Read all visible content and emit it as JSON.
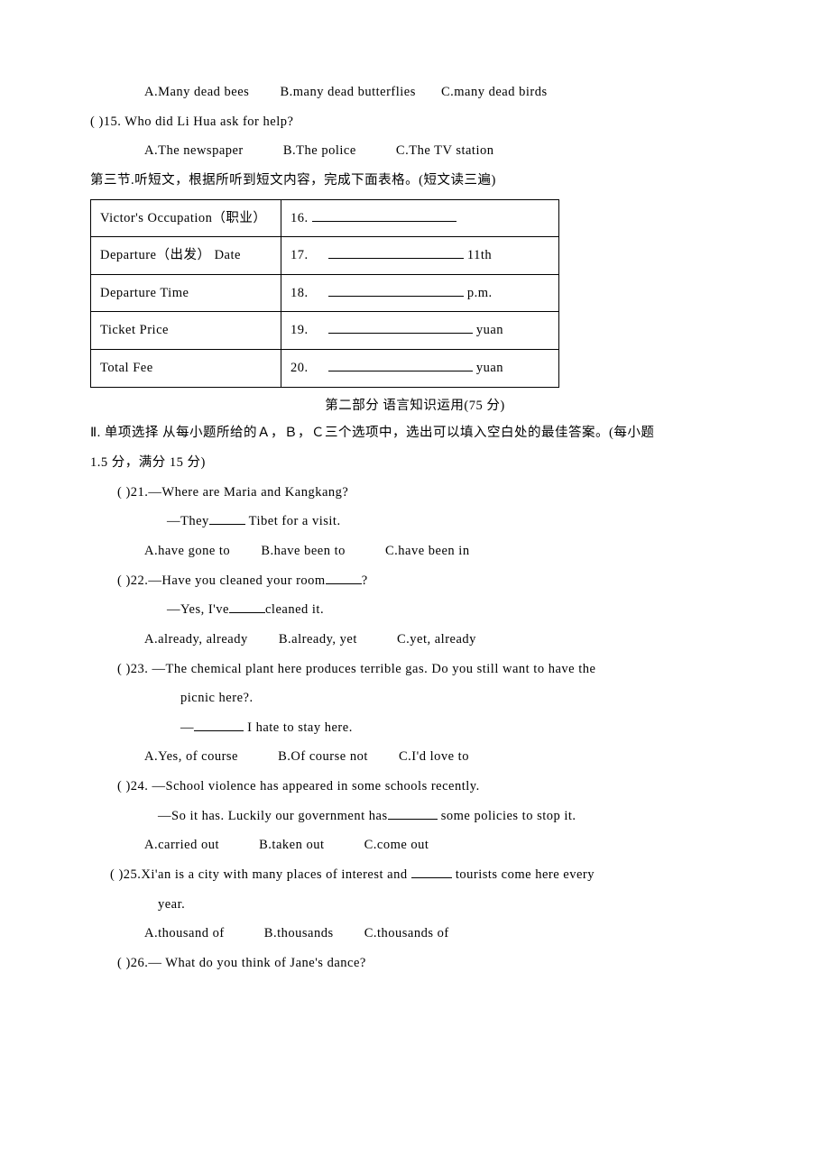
{
  "top": {
    "optsA": "A.Many dead bees",
    "optsB": "B.many dead butterflies",
    "optsC": "C.many dead birds",
    "q15": "(   )15. Who did Li Hua ask for help?",
    "q15A": "A.The newspaper",
    "q15B": "B.The police",
    "q15C": "C.The TV station"
  },
  "section3": {
    "title": "第三节.听短文，根据所听到短文内容，完成下面表格。(短文读三遍)",
    "rows": [
      {
        "left": "Victor's Occupation（职业）",
        "rightPrefix": "16.",
        "suffix": ""
      },
      {
        "left": "Departure（出发） Date",
        "rightPrefix": "17.",
        "suffix": "11th"
      },
      {
        "left": "Departure Time",
        "rightPrefix": "18.",
        "suffix": "p.m."
      },
      {
        "left": "Ticket Price",
        "rightPrefix": "19.",
        "suffix": "yuan"
      },
      {
        "left": "Total Fee",
        "rightPrefix": "20.",
        "suffix": "yuan"
      }
    ]
  },
  "part2": {
    "title": "第二部分  语言知识运用(75 分)",
    "instr1": "Ⅱ. 单项选择  从每小题所给的Ａ，Ｂ，Ｃ三个选项中，选出可以填入空白处的最佳答案。(每小题",
    "instr2": "1.5 分，满分 15 分)"
  },
  "q21": {
    "stem": "(   )21.—Where are Maria and Kangkang?",
    "sub": "—They",
    "subTail": " Tibet for a visit.",
    "A": "A.have gone to",
    "B": "B.have been to",
    "C": "C.have been in"
  },
  "q22": {
    "stem": "(   )22.—Have you cleaned your room",
    "stemTail": "?",
    "sub": "—Yes, I've",
    "subTail": "cleaned it.",
    "A": "A.already, already",
    "B": "B.already, yet",
    "C": "C.yet, already"
  },
  "q23": {
    "stem": "(   )23. —The chemical plant here produces terrible gas. Do you still want to have the",
    "cont": "picnic here?.",
    "sub": "—",
    "subTail": " I hate to stay here.",
    "A": "A.Yes, of course",
    "B": "B.Of course not",
    "C": "C.I'd love to"
  },
  "q24": {
    "stem": "(   )24. —School violence has appeared in some schools recently.",
    "sub": "—So it has. Luckily our government has",
    "subTail": " some policies to stop it.",
    "A": "A.carried out",
    "B": "B.taken out",
    "C": "C.come out"
  },
  "q25": {
    "stemPre": "(   )25.Xi'an is a city with many places of interest and ",
    "stemTail": " tourists come here every",
    "cont": "year.",
    "A": "A.thousand of",
    "B": "B.thousands",
    "C": "C.thousands of"
  },
  "q26": {
    "stem": "(   )26.— What do you think of Jane's dance?"
  }
}
